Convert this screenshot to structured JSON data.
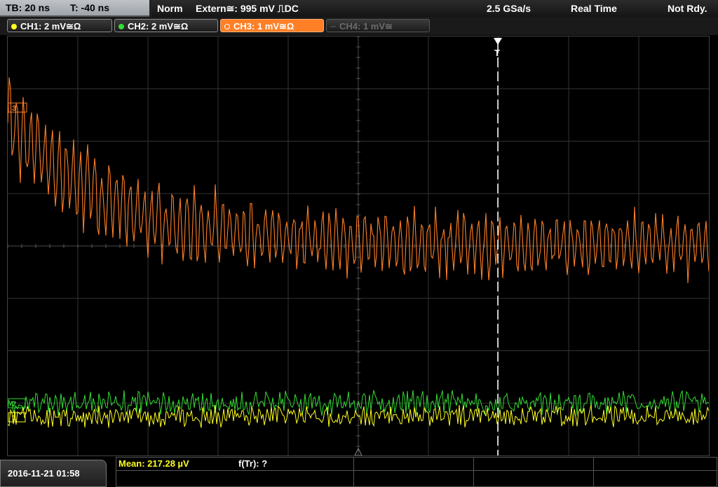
{
  "timebase": {
    "tb": "TB: 20 ns",
    "trigger_time": "T: -40 ns"
  },
  "status": {
    "mode": "Norm",
    "trigger": "Extern≅: 995 mV ⎍DC",
    "sample_rate": "2.5 GSa/s",
    "acq_mode": "Real Time",
    "state": "Not Rdy."
  },
  "channels": [
    {
      "label": "CH1: 2 mV≅Ω",
      "color": "#ffff22",
      "state": "on"
    },
    {
      "label": "CH2: 2 mV≅Ω",
      "color": "#33dd33",
      "state": "on"
    },
    {
      "label": "CH3: 1 mV≅Ω",
      "color": "#ff7f27",
      "state": "selected"
    },
    {
      "label": "CH4: 1 mV≅",
      "color": "#6b6b6b",
      "state": "off"
    }
  ],
  "trace_levels": {
    "ch3_marker": "3",
    "ch2_marker": "2",
    "ch1_marker": "1",
    "trigger_marker": "T"
  },
  "footer": {
    "datetime": "2016-11-21 01:58",
    "mean": "Mean: 217.28 µV",
    "ftr": "f(Tr): ?"
  }
}
